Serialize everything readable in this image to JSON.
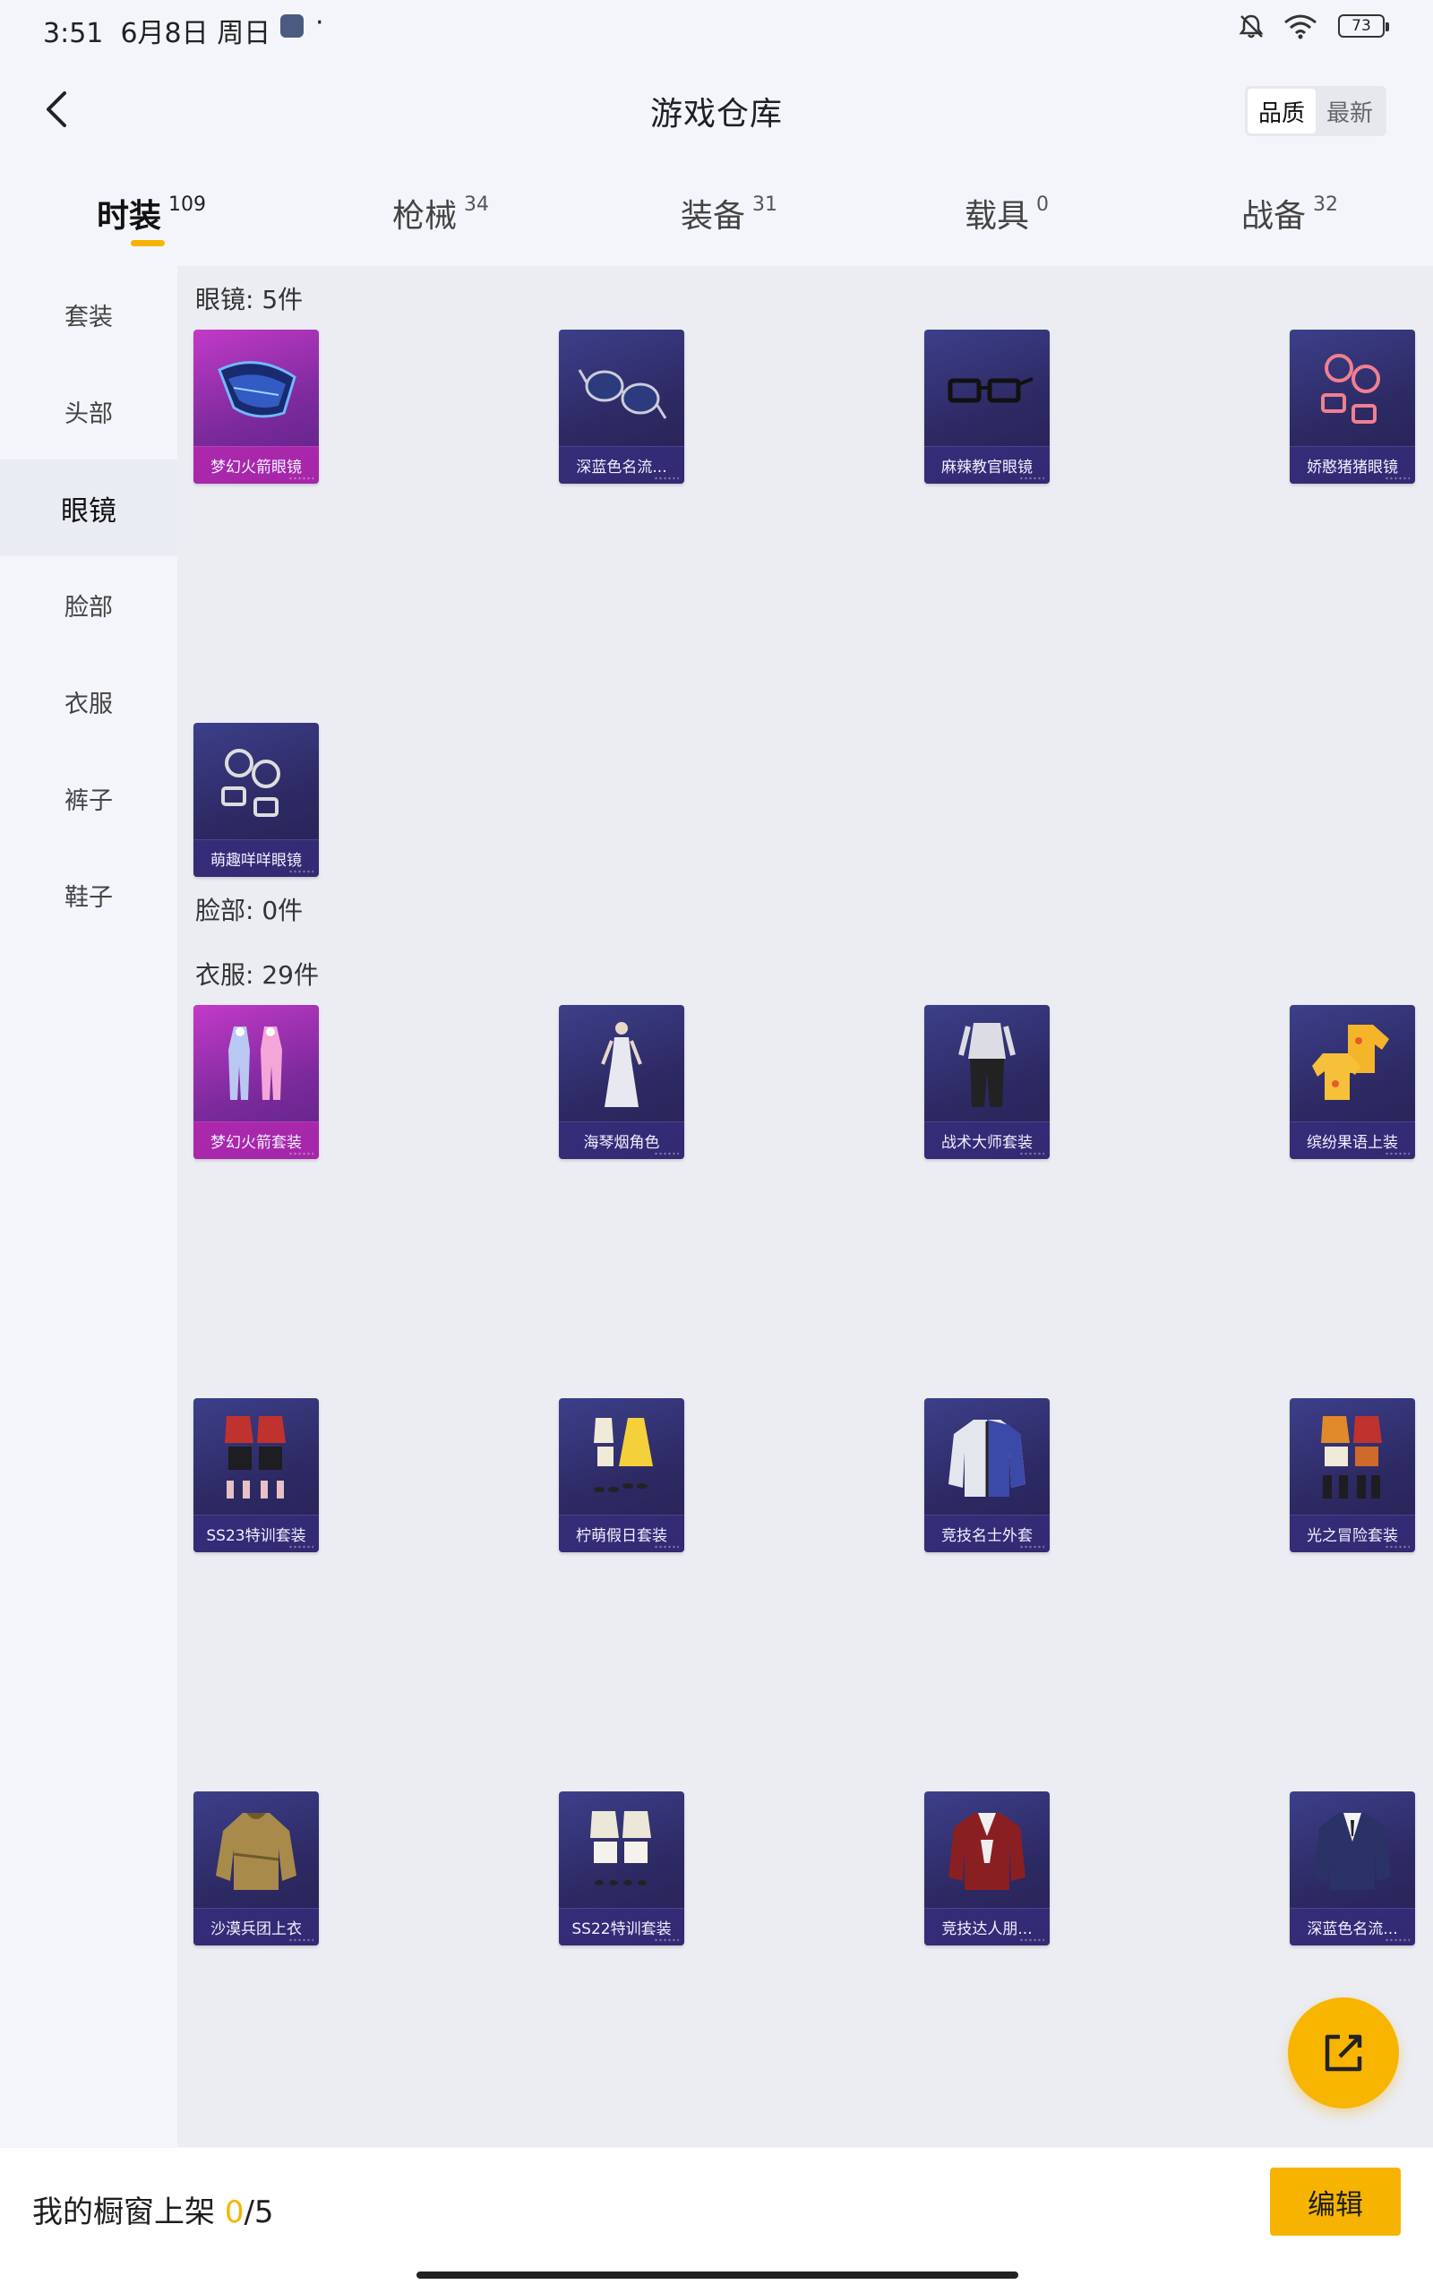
{
  "status_bar": {
    "time": "3:51",
    "date": "6月8日",
    "weekday": "周日",
    "separator": "·",
    "battery": "73"
  },
  "header": {
    "title": "游戏仓库",
    "sort": [
      {
        "label": "品质",
        "active": true
      },
      {
        "label": "最新",
        "active": false
      }
    ]
  },
  "tabs": [
    {
      "label": "时装",
      "count": "109",
      "active": true
    },
    {
      "label": "枪械",
      "count": "34",
      "active": false
    },
    {
      "label": "装备",
      "count": "31",
      "active": false
    },
    {
      "label": "载具",
      "count": "0",
      "active": false
    },
    {
      "label": "战备",
      "count": "32",
      "active": false
    }
  ],
  "sidebar": {
    "items": [
      {
        "label": "套装",
        "active": false
      },
      {
        "label": "头部",
        "active": false
      },
      {
        "label": "眼镜",
        "active": true
      },
      {
        "label": "脸部",
        "active": false
      },
      {
        "label": "衣服",
        "active": false
      },
      {
        "label": "裤子",
        "active": false
      },
      {
        "label": "鞋子",
        "active": false
      }
    ]
  },
  "sections": {
    "glasses": {
      "label": "眼镜: 5件",
      "items": [
        {
          "name": "梦幻火箭眼镜",
          "rarity": "pink",
          "icon": "visor-glasses-icon"
        },
        {
          "name": "深蓝色名流...",
          "rarity": "purple",
          "icon": "aviator-glasses-icon"
        },
        {
          "name": "麻辣教官眼镜",
          "rarity": "purple",
          "icon": "square-glasses-icon"
        },
        {
          "name": "娇憨猪猪眼镜",
          "rarity": "purple",
          "icon": "round-pink-glasses-icon"
        },
        {
          "name": "萌趣咩咩眼镜",
          "rarity": "purple",
          "icon": "round-glasses-icon"
        }
      ]
    },
    "face": {
      "label": "脸部: 0件"
    },
    "clothes": {
      "label": "衣服: 29件",
      "items": [
        {
          "name": "梦幻火箭套装",
          "rarity": "pink",
          "icon": "bodysuit-icon"
        },
        {
          "name": "海琴烟角色",
          "rarity": "purple",
          "icon": "character-icon"
        },
        {
          "name": "战术大师套装",
          "rarity": "purple",
          "icon": "tactical-suit-icon"
        },
        {
          "name": "缤纷果语上装",
          "rarity": "purple",
          "icon": "fruit-shirt-icon"
        },
        {
          "name": "SS23特训套装",
          "rarity": "purple",
          "icon": "training-set-icon"
        },
        {
          "name": "柠萌假日套装",
          "rarity": "purple",
          "icon": "holiday-dress-icon"
        },
        {
          "name": "竞技名士外套",
          "rarity": "purple",
          "icon": "jacket-icon"
        },
        {
          "name": "光之冒险套装",
          "rarity": "purple",
          "icon": "adventure-set-icon"
        },
        {
          "name": "沙漠兵团上衣",
          "rarity": "purple",
          "icon": "desert-coat-icon"
        },
        {
          "name": "SS22特训套装",
          "rarity": "purple",
          "icon": "training-set-icon"
        },
        {
          "name": "竞技达人朋...",
          "rarity": "purple",
          "icon": "red-jacket-icon"
        },
        {
          "name": "深蓝色名流...",
          "rarity": "purple",
          "icon": "suit-icon"
        }
      ]
    }
  },
  "bottom": {
    "showcase_prefix": "我的橱窗上架 ",
    "showcase_current": "0",
    "showcase_total": "/5",
    "edit_label": "编辑"
  },
  "colors": {
    "accent": "#f6b400",
    "card_purple": "#2d2963",
    "card_pink": "#c23ac8"
  }
}
